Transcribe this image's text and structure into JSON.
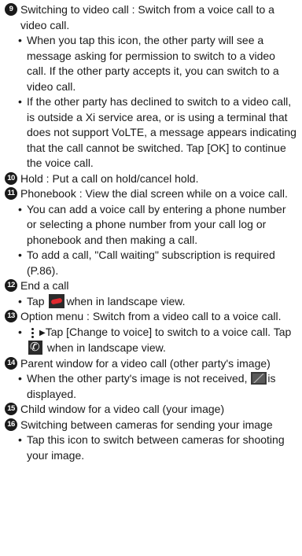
{
  "items": {
    "n9": {
      "num": "9",
      "text": "Switching to video call : Switch from a voice call to a video call.",
      "b1": "When you tap this icon, the other party will see a message asking for permission to switch to a video call. If the other party accepts it, you can switch to a video call.",
      "b2": "If the other party has declined to switch to a video call, is outside a Xi service area, or is using a terminal that does not support VoLTE, a message appears indicating that the call cannot be switched. Tap [OK] to continue the voice call."
    },
    "n10": {
      "num": "10",
      "text": "Hold : Put a call on hold/cancel hold."
    },
    "n11": {
      "num": "11",
      "text": "Phonebook : View the dial screen while on a voice call.",
      "b1": "You can add a voice call by entering a phone number or selecting a phone number from your call log or phonebook and then making a call.",
      "b2": "To add a call, \"Call waiting\" subscription is required (P.86)."
    },
    "n12": {
      "num": "12",
      "text": "End a call",
      "b1_pre": "Tap",
      "b1_post": "when in landscape view."
    },
    "n13": {
      "num": "13",
      "text": "Option menu : Switch from a video call to a voice call.",
      "b1_arrow": "▶",
      "b1_mid": "Tap [Change to voice] to switch to a voice call. Tap",
      "b1_post": "when in landscape view."
    },
    "n14": {
      "num": "14",
      "text": "Parent window for a video call (other party's image)",
      "b1_pre": "When the other party's image is not received,",
      "b1_post": "is displayed."
    },
    "n15": {
      "num": "15",
      "text": "Child window for a video call (your image)"
    },
    "n16": {
      "num": "16",
      "text": "Switching between cameras for sending your image",
      "b1": "Tap this icon to switch between cameras for shooting your image."
    }
  }
}
